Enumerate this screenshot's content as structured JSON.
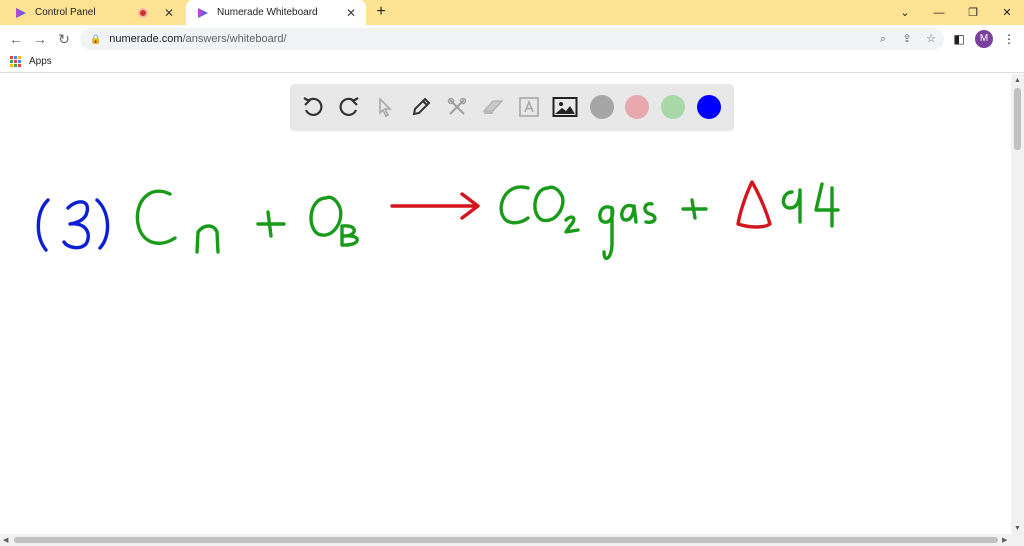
{
  "browser": {
    "tabs": [
      {
        "title": "Control Panel",
        "active": false
      },
      {
        "title": "Numerade Whiteboard",
        "active": true
      }
    ],
    "new_tab_icon": "plus-icon",
    "url_host": "numerade.com",
    "url_path": "/answers/whiteboard/",
    "avatar_initial": "M",
    "bookmarks": [
      {
        "label": "Apps",
        "icon": "apps-grid-icon"
      }
    ]
  },
  "whiteboard": {
    "tools": [
      "undo-icon",
      "redo-icon",
      "select-pointer-icon",
      "pen-icon",
      "tools-icon",
      "eraser-icon",
      "text-box-icon",
      "image-icon"
    ],
    "colors": [
      "#a6a6a6",
      "#e8a8ae",
      "#a8d8a8",
      "#0000ff"
    ],
    "selected_color": "#0000ff",
    "ink_colors": {
      "blue": "#0b1fd6",
      "green": "#1a9a1a",
      "red": "#d4141e"
    }
  }
}
